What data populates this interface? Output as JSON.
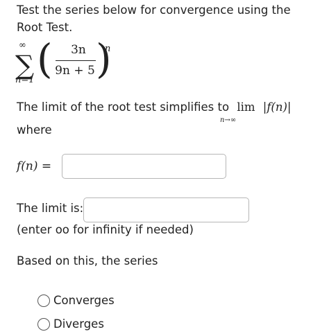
{
  "question": {
    "text": "Test the series below for convergence using the Root Test."
  },
  "series": {
    "sum_symbol": "∑",
    "upper_limit": "∞",
    "lower_limit": "n=1",
    "left_paren": "(",
    "right_paren": ")",
    "numerator": "3n",
    "denominator": "9n + 5",
    "exponent": "n"
  },
  "limit_statement": {
    "text": "The limit of the root test simplifies to",
    "lim": "lim",
    "lim_sub": "n→∞",
    "abs_expr": "|f(n)|"
  },
  "where_text": "where",
  "f_input": {
    "label": "f(n) =",
    "value": ""
  },
  "limit_input": {
    "label": "The limit is:",
    "value": ""
  },
  "hint_text": "(enter oo for infinity if needed)",
  "based_text": "Based on this, the series",
  "options": [
    {
      "label": "Converges"
    },
    {
      "label": "Diverges"
    }
  ]
}
